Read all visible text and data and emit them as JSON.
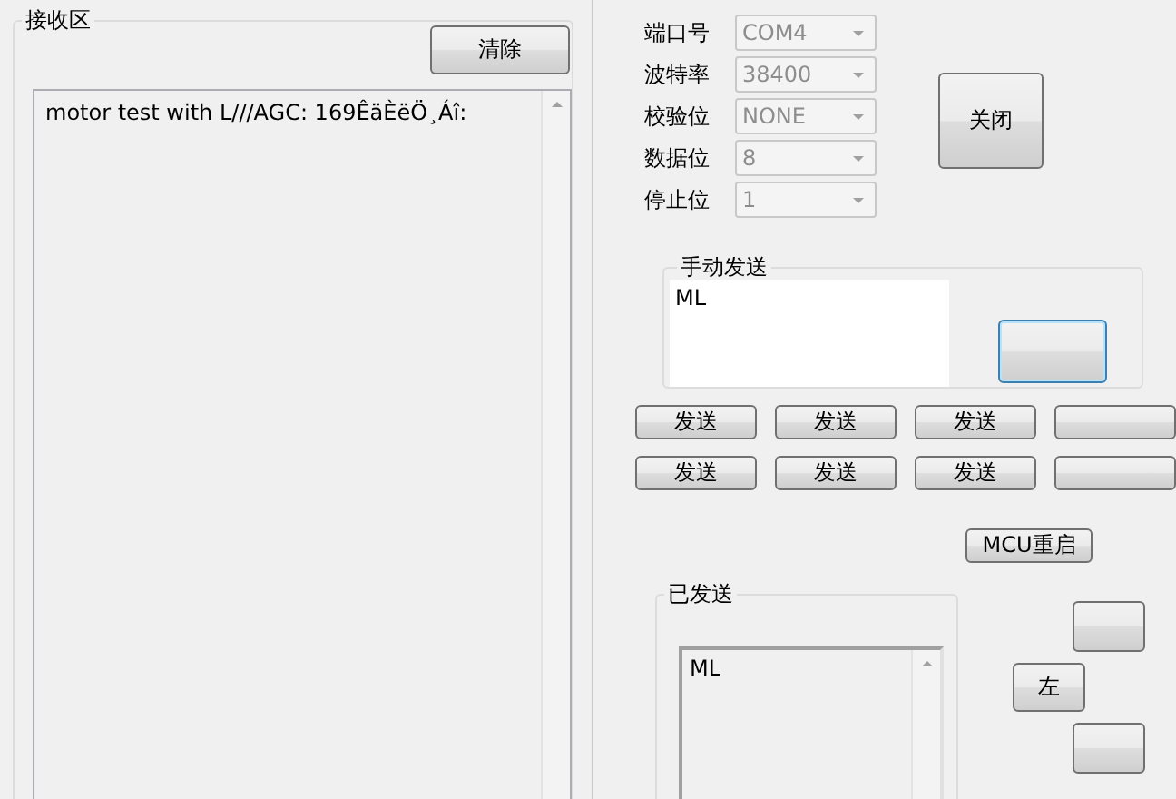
{
  "receive": {
    "title": "接收区",
    "clear_button": "清除",
    "text": "motor test with L///AGC: 169ÊäÈëÖ¸Áî:"
  },
  "serial_settings": [
    {
      "label": "端口号",
      "value": "COM4",
      "disabled": true
    },
    {
      "label": "波特率",
      "value": "38400",
      "disabled": true
    },
    {
      "label": "校验位",
      "value": "NONE",
      "disabled": true
    },
    {
      "label": "数据位",
      "value": "8",
      "disabled": true
    },
    {
      "label": "停止位",
      "value": "1",
      "disabled": true
    }
  ],
  "close_button": "关闭",
  "manual_send": {
    "title": "手动发送",
    "text": "ML"
  },
  "send_buttons": [
    [
      "发送",
      "发送",
      "发送"
    ],
    [
      "发送",
      "发送",
      "发送"
    ]
  ],
  "mcu_restart_button": "MCU重启",
  "sent": {
    "title": "已发送",
    "items": [
      "ML"
    ]
  },
  "direction_button": "左"
}
